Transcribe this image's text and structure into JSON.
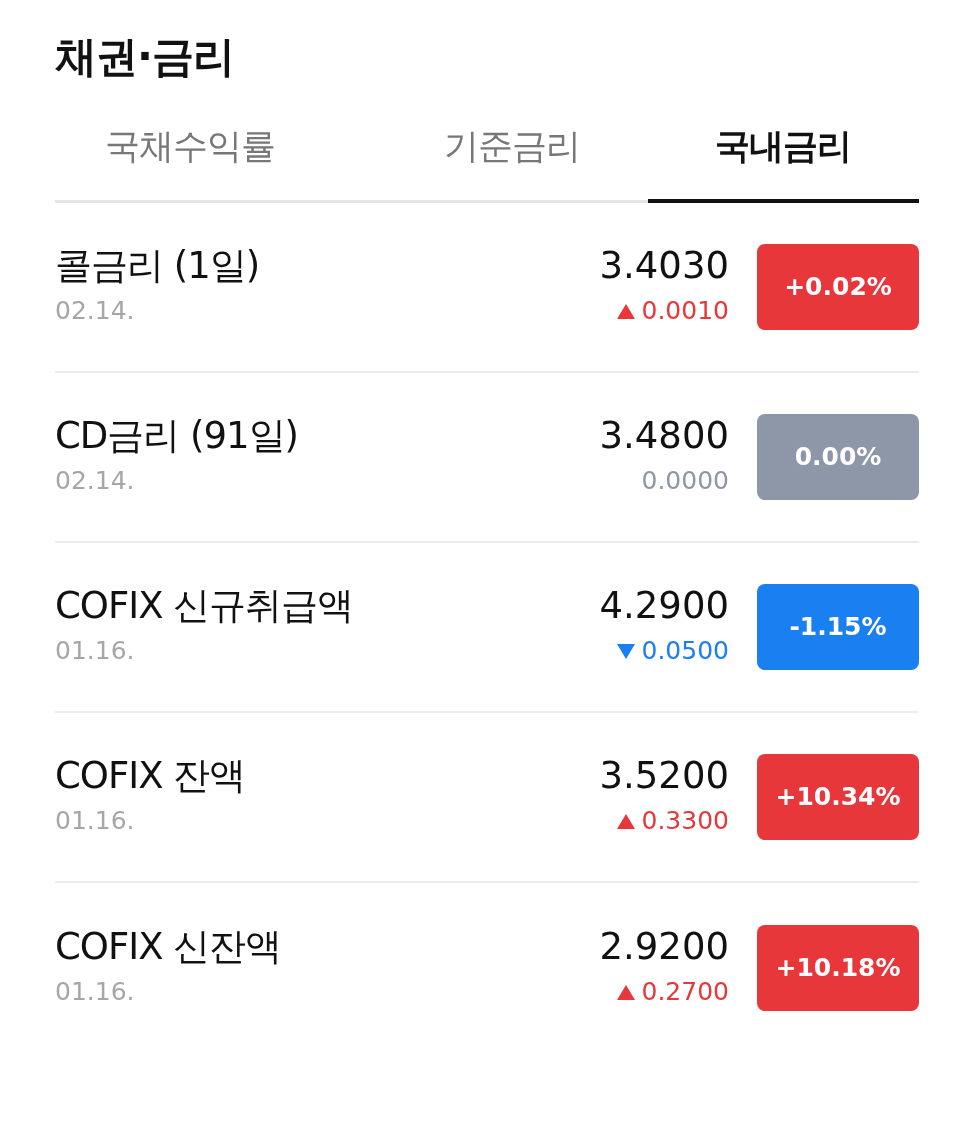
{
  "title": "채권·금리",
  "tabs": [
    {
      "label": "국채수익률",
      "selected": false
    },
    {
      "label": "기준금리",
      "selected": false
    },
    {
      "label": "국내금리",
      "selected": true
    }
  ],
  "rows": [
    {
      "name": "콜금리 (1일)",
      "date": "02.14.",
      "value": "3.4030",
      "kind": "up",
      "change": "0.0010",
      "percent": "+0.02%"
    },
    {
      "name": "CD금리 (91일)",
      "date": "02.14.",
      "value": "3.4800",
      "kind": "flat",
      "change": "0.0000",
      "percent": "0.00%"
    },
    {
      "name": "COFIX 신규취급액",
      "date": "01.16.",
      "value": "4.2900",
      "kind": "down",
      "change": "0.0500",
      "percent": "-1.15%"
    },
    {
      "name": "COFIX 잔액",
      "date": "01.16.",
      "value": "3.5200",
      "kind": "up",
      "change": "0.3300",
      "percent": "+10.34%"
    },
    {
      "name": "COFIX 신잔액",
      "date": "01.16.",
      "value": "2.9200",
      "kind": "up",
      "change": "0.2700",
      "percent": "+10.18%"
    }
  ]
}
